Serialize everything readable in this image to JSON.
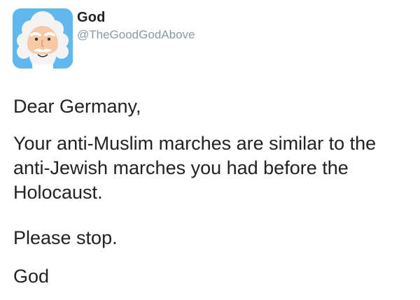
{
  "author": {
    "display_name": "God",
    "handle": "@TheGoodGodAbove",
    "avatar_icon": "bearded-god-avatar-icon"
  },
  "tweet": {
    "greeting": "Dear Germany,",
    "message": "Your anti-Muslim marches are similar to the anti-Jewish marches you had before the Holocaust.",
    "request": "Please stop.",
    "signature": "God"
  },
  "colors": {
    "avatar_background": "#61b8ef",
    "text": "#222222",
    "handle": "#8899a6"
  }
}
